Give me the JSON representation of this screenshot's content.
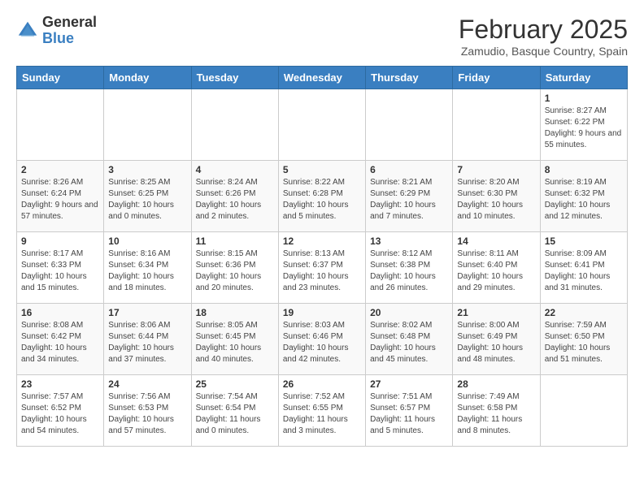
{
  "header": {
    "logo_general": "General",
    "logo_blue": "Blue",
    "month_title": "February 2025",
    "location": "Zamudio, Basque Country, Spain"
  },
  "days_of_week": [
    "Sunday",
    "Monday",
    "Tuesday",
    "Wednesday",
    "Thursday",
    "Friday",
    "Saturday"
  ],
  "weeks": [
    [
      {
        "day": "",
        "info": ""
      },
      {
        "day": "",
        "info": ""
      },
      {
        "day": "",
        "info": ""
      },
      {
        "day": "",
        "info": ""
      },
      {
        "day": "",
        "info": ""
      },
      {
        "day": "",
        "info": ""
      },
      {
        "day": "1",
        "info": "Sunrise: 8:27 AM\nSunset: 6:22 PM\nDaylight: 9 hours and 55 minutes."
      }
    ],
    [
      {
        "day": "2",
        "info": "Sunrise: 8:26 AM\nSunset: 6:24 PM\nDaylight: 9 hours and 57 minutes."
      },
      {
        "day": "3",
        "info": "Sunrise: 8:25 AM\nSunset: 6:25 PM\nDaylight: 10 hours and 0 minutes."
      },
      {
        "day": "4",
        "info": "Sunrise: 8:24 AM\nSunset: 6:26 PM\nDaylight: 10 hours and 2 minutes."
      },
      {
        "day": "5",
        "info": "Sunrise: 8:22 AM\nSunset: 6:28 PM\nDaylight: 10 hours and 5 minutes."
      },
      {
        "day": "6",
        "info": "Sunrise: 8:21 AM\nSunset: 6:29 PM\nDaylight: 10 hours and 7 minutes."
      },
      {
        "day": "7",
        "info": "Sunrise: 8:20 AM\nSunset: 6:30 PM\nDaylight: 10 hours and 10 minutes."
      },
      {
        "day": "8",
        "info": "Sunrise: 8:19 AM\nSunset: 6:32 PM\nDaylight: 10 hours and 12 minutes."
      }
    ],
    [
      {
        "day": "9",
        "info": "Sunrise: 8:17 AM\nSunset: 6:33 PM\nDaylight: 10 hours and 15 minutes."
      },
      {
        "day": "10",
        "info": "Sunrise: 8:16 AM\nSunset: 6:34 PM\nDaylight: 10 hours and 18 minutes."
      },
      {
        "day": "11",
        "info": "Sunrise: 8:15 AM\nSunset: 6:36 PM\nDaylight: 10 hours and 20 minutes."
      },
      {
        "day": "12",
        "info": "Sunrise: 8:13 AM\nSunset: 6:37 PM\nDaylight: 10 hours and 23 minutes."
      },
      {
        "day": "13",
        "info": "Sunrise: 8:12 AM\nSunset: 6:38 PM\nDaylight: 10 hours and 26 minutes."
      },
      {
        "day": "14",
        "info": "Sunrise: 8:11 AM\nSunset: 6:40 PM\nDaylight: 10 hours and 29 minutes."
      },
      {
        "day": "15",
        "info": "Sunrise: 8:09 AM\nSunset: 6:41 PM\nDaylight: 10 hours and 31 minutes."
      }
    ],
    [
      {
        "day": "16",
        "info": "Sunrise: 8:08 AM\nSunset: 6:42 PM\nDaylight: 10 hours and 34 minutes."
      },
      {
        "day": "17",
        "info": "Sunrise: 8:06 AM\nSunset: 6:44 PM\nDaylight: 10 hours and 37 minutes."
      },
      {
        "day": "18",
        "info": "Sunrise: 8:05 AM\nSunset: 6:45 PM\nDaylight: 10 hours and 40 minutes."
      },
      {
        "day": "19",
        "info": "Sunrise: 8:03 AM\nSunset: 6:46 PM\nDaylight: 10 hours and 42 minutes."
      },
      {
        "day": "20",
        "info": "Sunrise: 8:02 AM\nSunset: 6:48 PM\nDaylight: 10 hours and 45 minutes."
      },
      {
        "day": "21",
        "info": "Sunrise: 8:00 AM\nSunset: 6:49 PM\nDaylight: 10 hours and 48 minutes."
      },
      {
        "day": "22",
        "info": "Sunrise: 7:59 AM\nSunset: 6:50 PM\nDaylight: 10 hours and 51 minutes."
      }
    ],
    [
      {
        "day": "23",
        "info": "Sunrise: 7:57 AM\nSunset: 6:52 PM\nDaylight: 10 hours and 54 minutes."
      },
      {
        "day": "24",
        "info": "Sunrise: 7:56 AM\nSunset: 6:53 PM\nDaylight: 10 hours and 57 minutes."
      },
      {
        "day": "25",
        "info": "Sunrise: 7:54 AM\nSunset: 6:54 PM\nDaylight: 11 hours and 0 minutes."
      },
      {
        "day": "26",
        "info": "Sunrise: 7:52 AM\nSunset: 6:55 PM\nDaylight: 11 hours and 3 minutes."
      },
      {
        "day": "27",
        "info": "Sunrise: 7:51 AM\nSunset: 6:57 PM\nDaylight: 11 hours and 5 minutes."
      },
      {
        "day": "28",
        "info": "Sunrise: 7:49 AM\nSunset: 6:58 PM\nDaylight: 11 hours and 8 minutes."
      },
      {
        "day": "",
        "info": ""
      }
    ]
  ]
}
